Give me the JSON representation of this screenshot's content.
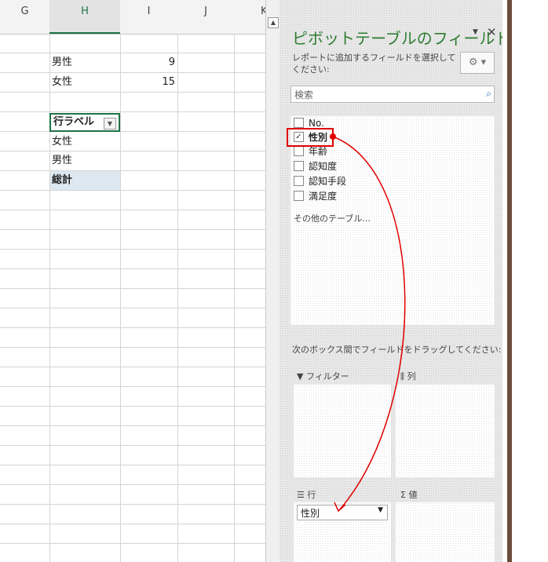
{
  "sheet": {
    "columns": [
      {
        "label": "G"
      },
      {
        "label": "H"
      },
      {
        "label": "I"
      },
      {
        "label": "J"
      },
      {
        "label": "K"
      }
    ],
    "summary": [
      {
        "label": "男性",
        "value": "9"
      },
      {
        "label": "女性",
        "value": "15"
      }
    ],
    "pivot": {
      "header": "行ラベル",
      "rows": [
        "女性",
        "男性"
      ],
      "total": "総計"
    }
  },
  "pane": {
    "title": "ピボットテーブルのフィールド",
    "subtitle": "レポートに追加するフィールドを選択してください:",
    "search_placeholder": "検索",
    "fields": [
      {
        "label": "No.",
        "checked": false
      },
      {
        "label": "性別",
        "checked": true
      },
      {
        "label": "年齢",
        "checked": false
      },
      {
        "label": "認知度",
        "checked": false
      },
      {
        "label": "認知手段",
        "checked": false
      },
      {
        "label": "満足度",
        "checked": false
      }
    ],
    "other_tables": "その他のテーブル...",
    "drag_instruction": "次のボックス間でフィールドをドラッグしてください:",
    "areas": {
      "filter": "フィルター",
      "columns": "列",
      "rows": "行",
      "values": "値"
    },
    "row_items": [
      "性別"
    ]
  },
  "colors": {
    "accent": "#217346",
    "title": "#2e7d32",
    "annotation": "#e00000"
  }
}
